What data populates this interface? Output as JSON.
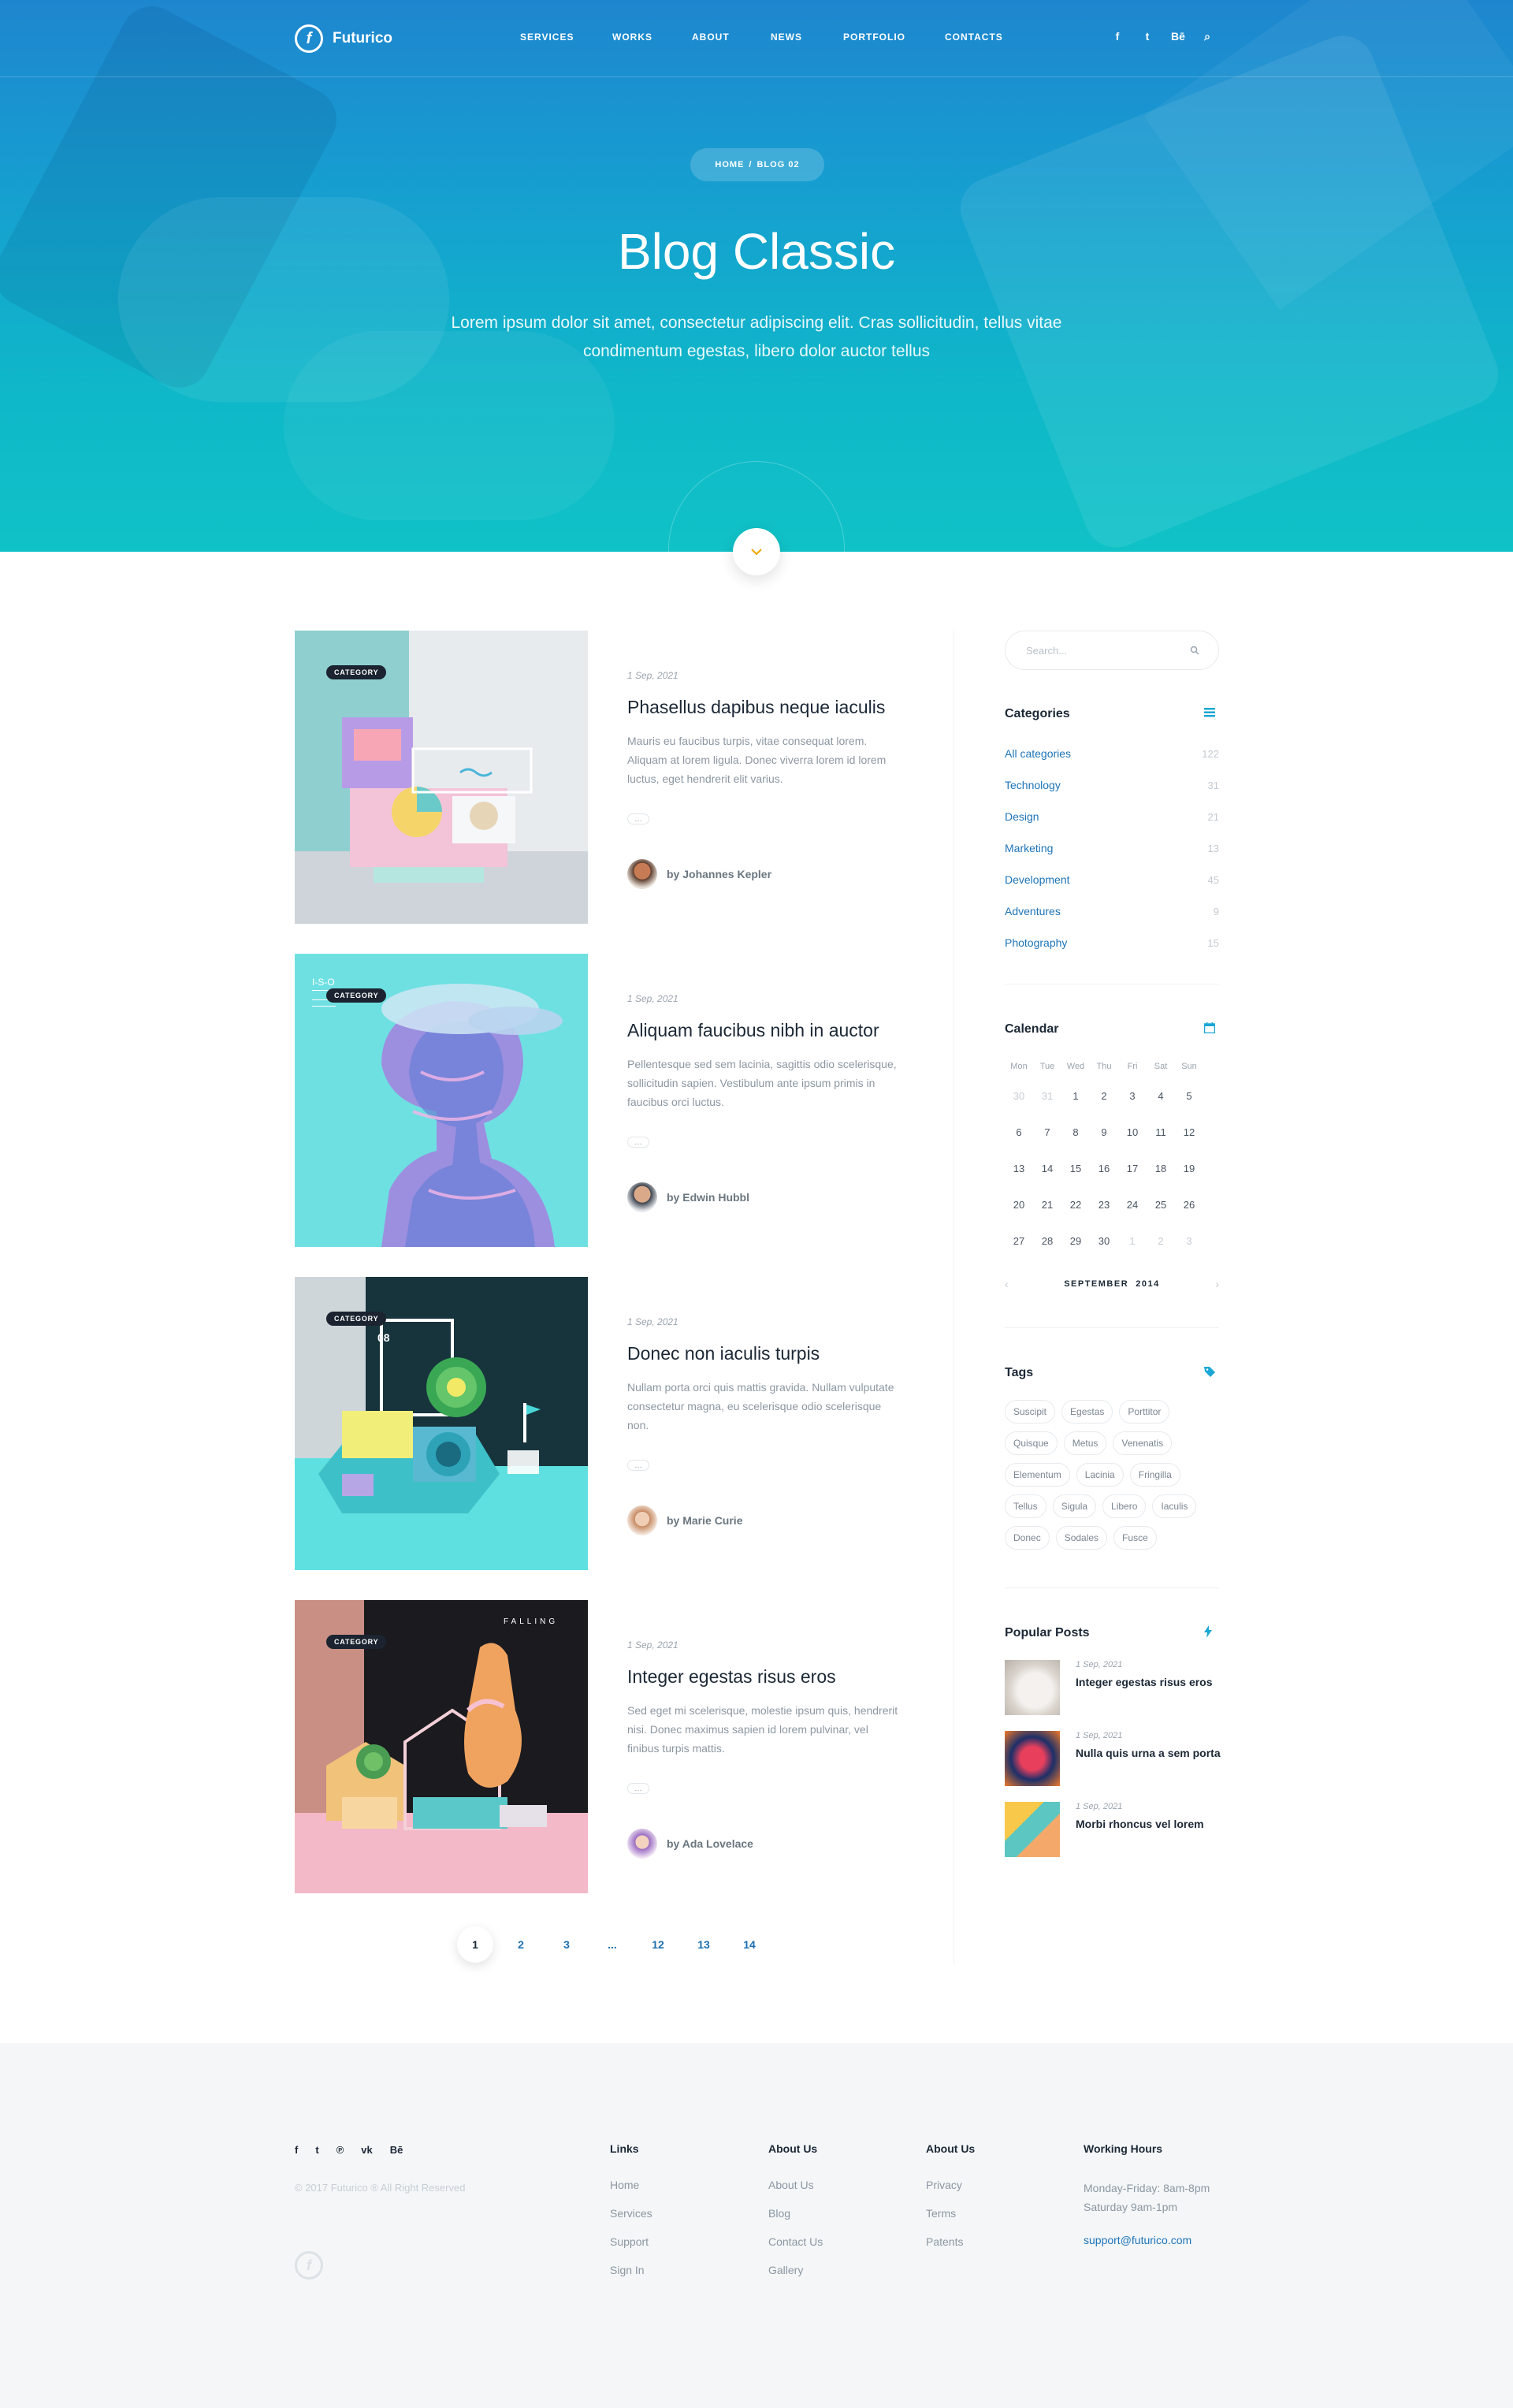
{
  "brand": {
    "name": "Futurico",
    "logo_letter": "f"
  },
  "nav": {
    "items": [
      "SERVICES",
      "WORKS",
      "ABOUT",
      "NEWS",
      "PORTFOLIO",
      "CONTACTS"
    ],
    "social": [
      "f",
      "t",
      "Bē",
      "⌕"
    ]
  },
  "hero": {
    "breadcrumb": {
      "home": "HOME",
      "separator": "/",
      "current": "BLOG 02"
    },
    "title": "Blog Classic",
    "subtitle": "Lorem ipsum dolor sit amet, consectetur adipiscing elit. Cras sollicitudin, tellus vitae condimentum egestas, libero dolor auctor tellus",
    "scroll_icon": "chevron-down-icon"
  },
  "posts": [
    {
      "category": "CATEGORY",
      "date": "1 Sep, 2021",
      "title": "Phasellus dapibus neque iaculis",
      "excerpt": "Mauris eu faucibus turpis, vitae consequat lorem. Aliquam at lorem ligula. Donec viverra lorem id lorem luctus, eget hendrerit elit varius.",
      "more": "…",
      "author": "by Johannes Kepler"
    },
    {
      "category": "CATEGORY",
      "date": "1 Sep, 2021",
      "title": "Aliquam faucibus nibh in auctor",
      "excerpt": "Pellentesque sed sem lacinia, sagittis odio scelerisque, sollicitudin sapien. Vestibulum ante ipsum primis in faucibus orci luctus.",
      "more": "…",
      "author": "by Edwin Hubbl"
    },
    {
      "category": "CATEGORY",
      "date": "1 Sep, 2021",
      "title": "Donec non iaculis turpis",
      "excerpt": "Nullam porta orci quis mattis gravida. Nullam vulputate consectetur magna, eu scelerisque odio scelerisque non.",
      "more": "…",
      "author": "by Marie Curie"
    },
    {
      "category": "CATEGORY",
      "date": "1 Sep, 2021",
      "title": "Integer egestas risus eros",
      "excerpt": "Sed eget mi scelerisque, molestie ipsum quis, hendrerit nisi. Donec maximus sapien id lorem pulvinar, vel finibus turpis mattis.",
      "more": "…",
      "author": "by Ada Lovelace"
    }
  ],
  "post_image_labels": {
    "iso": "I-S-O",
    "num": "08",
    "falling": "FALLING"
  },
  "pagination": [
    "1",
    "2",
    "3",
    "...",
    "12",
    "13",
    "14"
  ],
  "sidebar": {
    "search_placeholder": "Search...",
    "categories": {
      "title": "Categories",
      "items": [
        {
          "name": "All categories",
          "count": "122"
        },
        {
          "name": "Technology",
          "count": "31"
        },
        {
          "name": "Design",
          "count": "21"
        },
        {
          "name": "Marketing",
          "count": "13"
        },
        {
          "name": "Development",
          "count": "45"
        },
        {
          "name": "Adventures",
          "count": "9"
        },
        {
          "name": "Photography",
          "count": "15"
        }
      ]
    },
    "calendar": {
      "title": "Calendar",
      "days": [
        "Mon",
        "Tue",
        "Wed",
        "Thu",
        "Fri",
        "Sat",
        "Sun"
      ],
      "cells": [
        "30",
        "31",
        "1",
        "2",
        "3",
        "4",
        "5",
        "6",
        "7",
        "8",
        "9",
        "10",
        "11",
        "12",
        "13",
        "14",
        "15",
        "16",
        "17",
        "18",
        "19",
        "20",
        "21",
        "22",
        "23",
        "24",
        "25",
        "26",
        "27",
        "28",
        "29",
        "30",
        "1",
        "2",
        "3"
      ],
      "muted": [
        0,
        1,
        32,
        33,
        34
      ],
      "month": "SEPTEMBER",
      "year": "2014",
      "prev": "‹",
      "next": "›"
    },
    "tags": {
      "title": "Tags",
      "items": [
        "Suscipit",
        "Egestas",
        "Porttitor",
        "Quisque",
        "Metus",
        "Venenatis",
        "Elementum",
        "Lacinia",
        "Fringilla",
        "Tellus",
        "Sigula",
        "Libero",
        "Iaculis",
        "Donec",
        "Sodales",
        "Fusce"
      ]
    },
    "popular": {
      "title": "Popular Posts",
      "items": [
        {
          "date": "1 Sep, 2021",
          "title": "Integer egestas risus eros"
        },
        {
          "date": "1 Sep, 2021",
          "title": "Nulla quis urna a sem porta"
        },
        {
          "date": "1 Sep, 2021",
          "title": "Morbi rhoncus vel lorem"
        }
      ]
    }
  },
  "footer": {
    "social": [
      "f",
      "t",
      "℗",
      "vk",
      "Bē"
    ],
    "copyright": "© 2017 Futurico ® All Right Reserved",
    "columns": [
      {
        "title": "Links",
        "items": [
          "Home",
          "Services",
          "Support",
          "Sign In"
        ]
      },
      {
        "title": "About Us",
        "items": [
          "About Us",
          "Blog",
          "Contact Us",
          "Gallery"
        ]
      },
      {
        "title": "About Us",
        "items": [
          "Privacy",
          "Terms",
          "Patents"
        ]
      }
    ],
    "hours": {
      "title": "Working Hours",
      "line1": "Monday-Friday: 8am-8pm",
      "line2": "Saturday 9am-1pm",
      "email": "support@futurico.com"
    }
  },
  "colors": {
    "accent": "#1d74b8",
    "hero_top": "#1e86cf",
    "hero_bottom": "#10c2c7",
    "scroll_icon": "#f0a500"
  }
}
